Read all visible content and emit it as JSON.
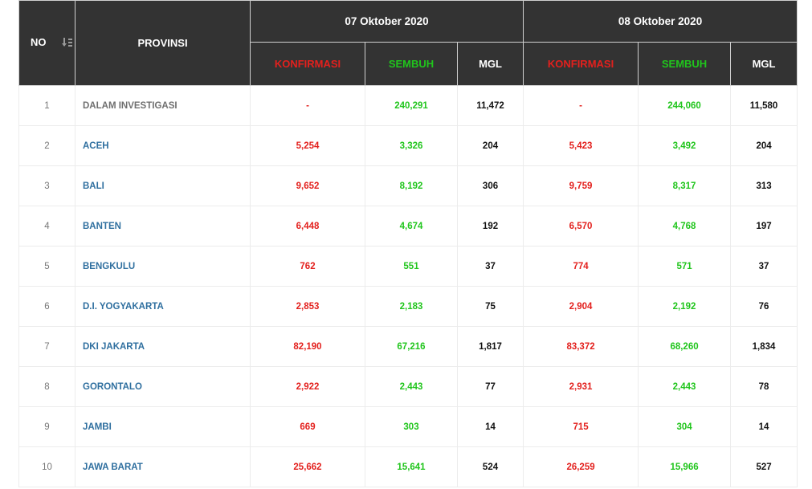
{
  "header": {
    "no_label": "NO",
    "provinsi_label": "PROVINSI",
    "dates": [
      "07 Oktober 2020",
      "08 Oktober 2020"
    ],
    "konfirmasi_label": "KONFIRMASI",
    "sembuh_label": "SEMBUH",
    "mgl_label": "MGL",
    "sort_icon": "sort-icon"
  },
  "colors": {
    "header_bg": "#333333",
    "konfirmasi": "#e3201d",
    "sembuh": "#20c51c",
    "province_link": "#2f6f9f"
  },
  "rows": [
    {
      "no": "1",
      "provinsi": "DALAM INVESTIGASI",
      "d1_konfirmasi": "-",
      "d1_sembuh": "240,291",
      "d1_mgl": "11,472",
      "d2_konfirmasi": "-",
      "d2_sembuh": "244,060",
      "d2_mgl": "11,580"
    },
    {
      "no": "2",
      "provinsi": "ACEH",
      "d1_konfirmasi": "5,254",
      "d1_sembuh": "3,326",
      "d1_mgl": "204",
      "d2_konfirmasi": "5,423",
      "d2_sembuh": "3,492",
      "d2_mgl": "204"
    },
    {
      "no": "3",
      "provinsi": "BALI",
      "d1_konfirmasi": "9,652",
      "d1_sembuh": "8,192",
      "d1_mgl": "306",
      "d2_konfirmasi": "9,759",
      "d2_sembuh": "8,317",
      "d2_mgl": "313"
    },
    {
      "no": "4",
      "provinsi": "BANTEN",
      "d1_konfirmasi": "6,448",
      "d1_sembuh": "4,674",
      "d1_mgl": "192",
      "d2_konfirmasi": "6,570",
      "d2_sembuh": "4,768",
      "d2_mgl": "197"
    },
    {
      "no": "5",
      "provinsi": "BENGKULU",
      "d1_konfirmasi": "762",
      "d1_sembuh": "551",
      "d1_mgl": "37",
      "d2_konfirmasi": "774",
      "d2_sembuh": "571",
      "d2_mgl": "37"
    },
    {
      "no": "6",
      "provinsi": "D.I. YOGYAKARTA",
      "d1_konfirmasi": "2,853",
      "d1_sembuh": "2,183",
      "d1_mgl": "75",
      "d2_konfirmasi": "2,904",
      "d2_sembuh": "2,192",
      "d2_mgl": "76"
    },
    {
      "no": "7",
      "provinsi": "DKI JAKARTA",
      "d1_konfirmasi": "82,190",
      "d1_sembuh": "67,216",
      "d1_mgl": "1,817",
      "d2_konfirmasi": "83,372",
      "d2_sembuh": "68,260",
      "d2_mgl": "1,834"
    },
    {
      "no": "8",
      "provinsi": "GORONTALO",
      "d1_konfirmasi": "2,922",
      "d1_sembuh": "2,443",
      "d1_mgl": "77",
      "d2_konfirmasi": "2,931",
      "d2_sembuh": "2,443",
      "d2_mgl": "78"
    },
    {
      "no": "9",
      "provinsi": "JAMBI",
      "d1_konfirmasi": "669",
      "d1_sembuh": "303",
      "d1_mgl": "14",
      "d2_konfirmasi": "715",
      "d2_sembuh": "304",
      "d2_mgl": "14"
    },
    {
      "no": "10",
      "provinsi": "JAWA BARAT",
      "d1_konfirmasi": "25,662",
      "d1_sembuh": "15,641",
      "d1_mgl": "524",
      "d2_konfirmasi": "26,259",
      "d2_sembuh": "15,966",
      "d2_mgl": "527"
    }
  ]
}
